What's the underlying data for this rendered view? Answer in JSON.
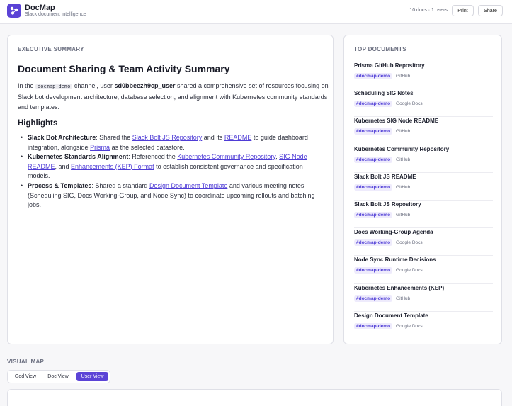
{
  "app": {
    "name": "DocMap",
    "tagline": "Slack document intelligence",
    "logo_icon": "network-icon",
    "accent_color": "#5b43d6"
  },
  "header": {
    "stats": "10 docs · 1 users",
    "print_label": "Print",
    "share_label": "Share"
  },
  "summary": {
    "section_label": "EXECUTIVE SUMMARY",
    "title": "Document Sharing & Team Activity Summary",
    "intro": {
      "p1": "In the ",
      "channel": "docmap-demo",
      "p2": " channel, user ",
      "user": "sd0bbeezh9cp_user",
      "p3": " shared a comprehensive set of resources focusing on Slack bot development architecture, database selection, and alignment with Kubernetes community standards and templates."
    },
    "highlights_title": "Highlights",
    "highlights": [
      {
        "label": "Slack Bot Architecture",
        "t1": ": Shared the ",
        "l1": "Slack Bolt JS Repository",
        "t2": " and its ",
        "l2": "README",
        "t3": " to guide dashboard integration, alongside ",
        "l3": "Prisma",
        "t4": " as the selected datastore."
      },
      {
        "label": "Kubernetes Standards Alignment",
        "t1": ": Referenced the ",
        "l1": "Kubernetes Community Repository",
        "t2": ", ",
        "l2": "SIG Node README",
        "t3": ", and ",
        "l3": "Enhancements (KEP) Format",
        "t4": " to establish consistent governance and specification models."
      },
      {
        "label": "Process & Templates",
        "t1": ": Shared a standard ",
        "l1": "Design Document Template",
        "t2": " and various meeting notes (Scheduling SIG, Docs Working-Group, and Node Sync) to coordinate upcoming rollouts and batching jobs."
      }
    ]
  },
  "top_documents": {
    "section_label": "TOP DOCUMENTS",
    "items": [
      {
        "title": "Prisma GitHub Repository",
        "channel": "#docmap-demo",
        "source": "GitHub"
      },
      {
        "title": "Scheduling SIG Notes",
        "channel": "#docmap-demo",
        "source": "Google Docs"
      },
      {
        "title": "Kubernetes SIG Node README",
        "channel": "#docmap-demo",
        "source": "GitHub"
      },
      {
        "title": "Kubernetes Community Repository",
        "channel": "#docmap-demo",
        "source": "GitHub"
      },
      {
        "title": "Slack Bolt JS README",
        "channel": "#docmap-demo",
        "source": "GitHub"
      },
      {
        "title": "Slack Bolt JS Repository",
        "channel": "#docmap-demo",
        "source": "GitHub"
      },
      {
        "title": "Docs Working-Group Agenda",
        "channel": "#docmap-demo",
        "source": "Google Docs"
      },
      {
        "title": "Node Sync Runtime Decisions",
        "channel": "#docmap-demo",
        "source": "Google Docs"
      },
      {
        "title": "Kubernetes Enhancements (KEP)",
        "channel": "#docmap-demo",
        "source": "GitHub"
      },
      {
        "title": "Design Document Template",
        "channel": "#docmap-demo",
        "source": "Google Docs"
      }
    ]
  },
  "visual_map": {
    "section_label": "VISUAL MAP",
    "tabs": [
      {
        "label": "God View",
        "active": false
      },
      {
        "label": "Doc View",
        "active": false
      },
      {
        "label": "User View",
        "active": true
      }
    ]
  }
}
